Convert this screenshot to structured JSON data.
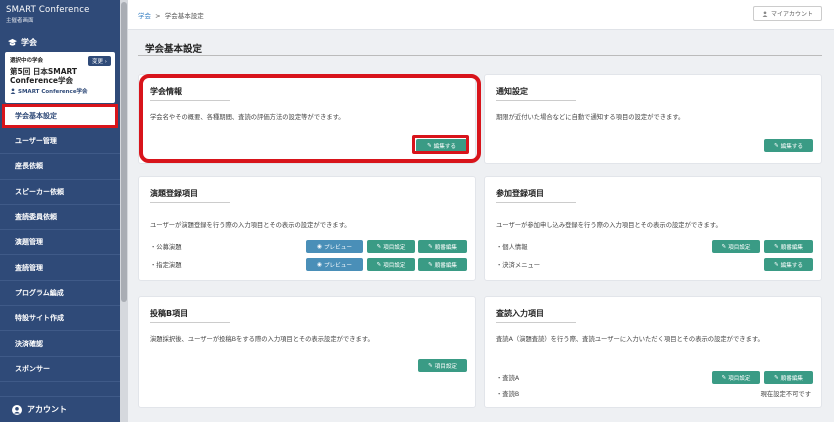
{
  "brand": {
    "title": "SMART Conference",
    "sub": "主催者画面"
  },
  "sidebar": {
    "section": "学会",
    "card": {
      "label": "選択中の学会",
      "change": "変更",
      "name": "第5回 日本SMART Conference学会",
      "org": "SMART Conference学会"
    },
    "items": [
      {
        "label": "学会基本設定"
      },
      {
        "label": "ユーザー管理"
      },
      {
        "label": "座長依頼"
      },
      {
        "label": "スピーカー依頼"
      },
      {
        "label": "査読委員依頼"
      },
      {
        "label": "演題管理"
      },
      {
        "label": "査読管理"
      },
      {
        "label": "プログラム編成"
      },
      {
        "label": "特設サイト作成"
      },
      {
        "label": "決済確認"
      },
      {
        "label": "スポンサー"
      }
    ],
    "account": "アカウント"
  },
  "topbar": {
    "crumb_root": "学会",
    "crumb_sep": ">",
    "crumb_current": "学会基本設定",
    "account_btn": "マイアカウント"
  },
  "page": {
    "title": "学会基本設定"
  },
  "cards": {
    "info": {
      "title": "学会情報",
      "desc": "学会名やその概要、各種期間、査読の評価方法の設定等ができます。",
      "btn": "編集する"
    },
    "notify": {
      "title": "通知設定",
      "desc": "期限が近付いた場合などに自動で通知する項目の設定ができます。",
      "btn": "編集する"
    },
    "abstract": {
      "title": "演題登録項目",
      "desc": "ユーザーが演題登録を行う際の入力項目とその表示の設定ができます。",
      "rows": [
        {
          "label": "・公募演題",
          "preview": "プレビュー",
          "items": "項目設定",
          "order": "順番編集"
        },
        {
          "label": "・指定演題",
          "preview": "プレビュー",
          "items": "項目設定",
          "order": "順番編集"
        }
      ]
    },
    "participation": {
      "title": "参加登録項目",
      "desc": "ユーザーが参加申し込み登録を行う際の入力項目とその表示の設定ができます。",
      "rows": [
        {
          "label": "・個人情報",
          "items": "項目設定",
          "order": "順番編集"
        },
        {
          "label": "・決済メニュー",
          "edit": "編集する"
        }
      ]
    },
    "postB": {
      "title": "投稿B項目",
      "desc": "演題採択後、ユーザーが投稿Bをする際の入力項目とその表示設定ができます。",
      "btn": "項目設定"
    },
    "review": {
      "title": "査読入力項目",
      "desc": "査読A（演題査読）を行う際、査読ユーザーに入力いただく項目とその表示の設定ができます。",
      "rows": [
        {
          "label": "・査読A",
          "items": "項目設定",
          "order": "順番編集"
        },
        {
          "label": "・査読B",
          "note": "現在設定不可です"
        }
      ]
    }
  },
  "colors": {
    "sidebar": "#2f4a78",
    "button": "#3a9b85",
    "preview": "#4a8fb8",
    "highlight": "#d8141b"
  }
}
